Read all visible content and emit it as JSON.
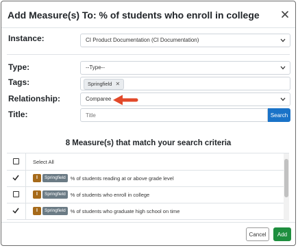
{
  "modal": {
    "title": "Add Measure(s) To: % of students who enroll in college"
  },
  "form": {
    "instance": {
      "label": "Instance:",
      "value": "CI Product Documentation (CI Documentation)"
    },
    "type": {
      "label": "Type:",
      "value": "--Type--"
    },
    "tags": {
      "label": "Tags:",
      "chips": [
        "Springfield"
      ]
    },
    "relationship": {
      "label": "Relationship:",
      "value": "Comparee"
    },
    "title": {
      "label": "Title:",
      "placeholder": "Title"
    },
    "search_label": "Search"
  },
  "results": {
    "heading": "8 Measure(s) that match your search criteria",
    "select_all": "Select All",
    "rows": [
      {
        "checked": true,
        "type_badge": "I",
        "tag": "Springfield",
        "text": "% of students reading at or above grade level"
      },
      {
        "checked": false,
        "type_badge": "I",
        "tag": "Springfield",
        "text": "% of students who enroll in college"
      },
      {
        "checked": true,
        "type_badge": "I",
        "tag": "Springfield",
        "text": "% of students who graduate high school on time"
      }
    ]
  },
  "footer": {
    "cancel_label": "Cancel",
    "add_label": "Add"
  },
  "colors": {
    "primary_blue": "#1a73c8",
    "add_green": "#1e8e3e",
    "arrow_red": "#e2492a",
    "badge_brown": "#a66a1a",
    "badge_gray": "#6b7b85"
  }
}
